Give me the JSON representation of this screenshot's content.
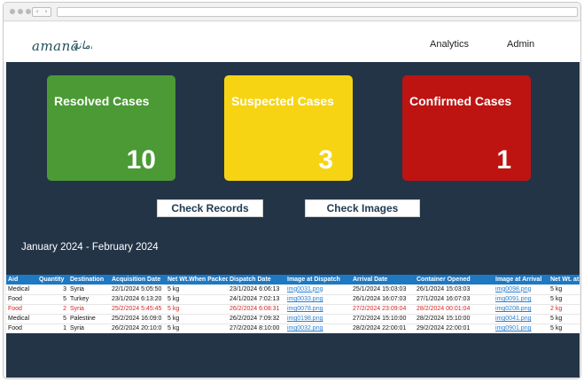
{
  "brand": {
    "logo_text": "amanā أمانة"
  },
  "nav": {
    "analytics": "Analytics",
    "admin": "Admin"
  },
  "cards": [
    {
      "title": "Resolved Cases",
      "count": "10",
      "color": "#4b9a35"
    },
    {
      "title": "Suspected Cases",
      "count": "3",
      "color": "#f6d413"
    },
    {
      "title": "Confirmed Cases",
      "count": "1",
      "color": "#bd1412"
    }
  ],
  "buttons": {
    "check_records": "Check Records",
    "check_images": "Check Images"
  },
  "period": "January 2024 - February 2024",
  "colors": {
    "dashboard_bg": "#233447",
    "table_header": "#1e78c2",
    "alert_row": "#d8231f",
    "link": "#2a7fd0"
  },
  "table": {
    "headers": [
      "Aid",
      "Quantity",
      "Destination",
      "Acquisition Date",
      "Net Wt.When Packed",
      "Dispatch Date",
      "Image at Dispatch",
      "Arrival Date",
      "Container Opened",
      "Image at Arrival",
      "Net Wt. at"
    ],
    "rows": [
      {
        "aid": "Medical",
        "quantity": "3",
        "destination": "Syria",
        "acquisition": "22/1/2024 5:05:50",
        "net_wt": "5 kg",
        "dispatch": "23/1/2024 6:06:13",
        "img_dispatch": "img0031.png",
        "arrival": "25/1/2024 15:03:03",
        "opened": "26/1/2024 15:03:03",
        "img_arrival": "img0098.png",
        "net_wt_at": "5 kg",
        "flagged": false
      },
      {
        "aid": "Food",
        "quantity": "5",
        "destination": "Turkey",
        "acquisition": "23/1/2024 6:13:20",
        "net_wt": "5 kg",
        "dispatch": "24/1/2024 7:02:13",
        "img_dispatch": "img0033.png",
        "arrival": "26/1/2024 16:07:03",
        "opened": "27/1/2024 16:07:03",
        "img_arrival": "img0091.png",
        "net_wt_at": "5 kg",
        "flagged": false
      },
      {
        "aid": "Food",
        "quantity": "2",
        "destination": "Syria",
        "acquisition": "25/2/2024 5:45:45",
        "net_wt": "5 kg",
        "dispatch": "26/2/2024 6:08:31",
        "img_dispatch": "img0078.png",
        "arrival": "27/2/2024 23:09:04",
        "opened": "28/2/2024 00:01:04",
        "img_arrival": "img0208.png",
        "net_wt_at": "2 kg",
        "flagged": true
      },
      {
        "aid": "Medical",
        "quantity": "5",
        "destination": "Palestine",
        "acquisition": "25/2/2024 16:09:0",
        "net_wt": "5 kg",
        "dispatch": "26/2/2024 7:09:32",
        "img_dispatch": "img0198.png",
        "arrival": "27/2/2024 15:10:00",
        "opened": "28/2/2024 15:10:00",
        "img_arrival": "img0041.png",
        "net_wt_at": "5 kg",
        "flagged": false
      },
      {
        "aid": "Food",
        "quantity": "1",
        "destination": "Syria",
        "acquisition": "26/2/2024 20:10:0",
        "net_wt": "5 kg",
        "dispatch": "27/2/2024 8:10:00",
        "img_dispatch": "img0032.png",
        "arrival": "28/2/2024 22:00:01",
        "opened": "29/2/2024 22:00:01",
        "img_arrival": "img0901.png",
        "net_wt_at": "5 kg",
        "flagged": false
      }
    ]
  }
}
